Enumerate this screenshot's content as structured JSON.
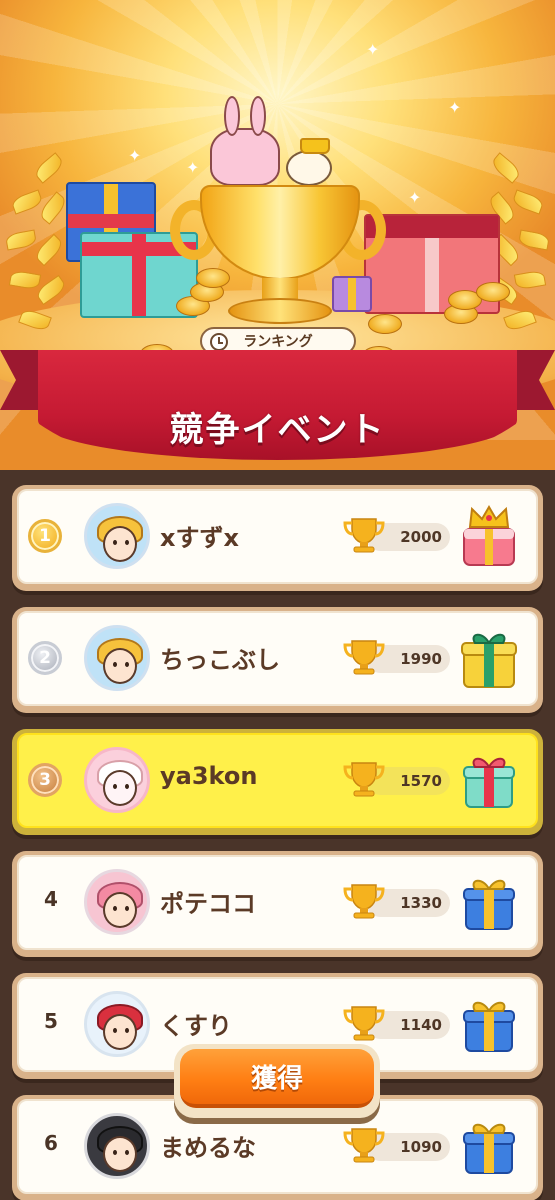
{
  "hero": {
    "ranking_label": "ランキング",
    "event_title": "競争イベント"
  },
  "colors": {
    "banner_red": "#c51a33",
    "highlight_row": "#fff04a",
    "claim_orange": "#ff7f14",
    "background_brown": "#4a3429"
  },
  "leaderboard": [
    {
      "rank": "1",
      "medal": "gold",
      "name": "xすずx",
      "score": "2000",
      "reward_icon": "crown-cake-icon",
      "highlight": false
    },
    {
      "rank": "2",
      "medal": "silver",
      "name": "ちっこぶし",
      "score": "1990",
      "reward_icon": "large-gift-icon",
      "highlight": false
    },
    {
      "rank": "3",
      "medal": "bronze",
      "name": "ya3kon",
      "score": "1570",
      "reward_icon": "medium-gift-icon",
      "highlight": true
    },
    {
      "rank": "4",
      "medal": "",
      "name": "ポテココ",
      "score": "1330",
      "reward_icon": "blue-gift-icon",
      "highlight": false
    },
    {
      "rank": "5",
      "medal": "",
      "name": "くすり",
      "score": "1140",
      "reward_icon": "blue-gift-icon",
      "highlight": false
    },
    {
      "rank": "6",
      "medal": "",
      "name": "まめるな",
      "score": "1090",
      "reward_icon": "blue-gift-icon",
      "highlight": false
    }
  ],
  "claim_button": {
    "label": "獲得"
  }
}
